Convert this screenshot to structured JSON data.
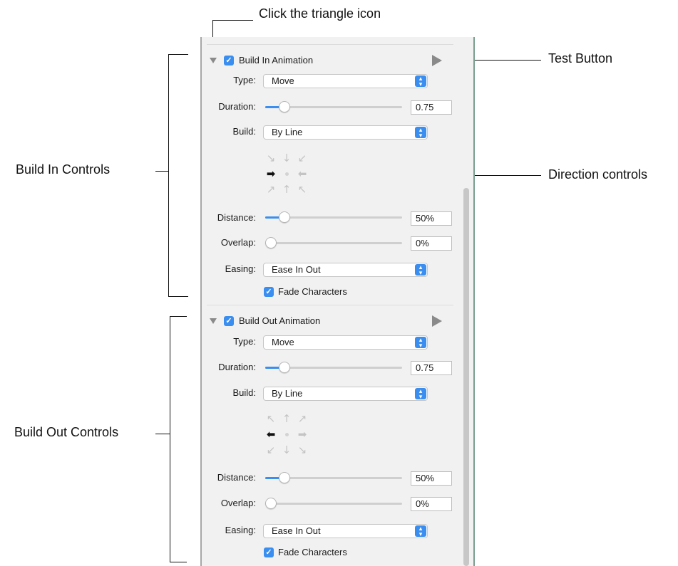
{
  "annotations": {
    "triangle_callout": "Click the triangle icon",
    "test_button_callout": "Test Button",
    "direction_callout": "Direction controls",
    "build_in_callout": "Build In Controls",
    "build_out_callout": "Build Out Controls"
  },
  "build_in": {
    "title": "Build In Animation",
    "enabled": true,
    "type_label": "Type:",
    "type_value": "Move",
    "duration_label": "Duration:",
    "duration_value": "0.75",
    "duration_level": 0.11,
    "build_label": "Build:",
    "build_value": "By Line",
    "direction": "right",
    "distance_label": "Distance:",
    "distance_value": "50%",
    "distance_level": 0.11,
    "overlap_label": "Overlap:",
    "overlap_value": "0%",
    "overlap_level": 0.0,
    "easing_label": "Easing:",
    "easing_value": "Ease In Out",
    "fade_label": "Fade Characters",
    "fade_checked": true
  },
  "build_out": {
    "title": "Build Out Animation",
    "enabled": true,
    "type_label": "Type:",
    "type_value": "Move",
    "duration_label": "Duration:",
    "duration_value": "0.75",
    "duration_level": 0.11,
    "build_label": "Build:",
    "build_value": "By Line",
    "direction": "left",
    "distance_label": "Distance:",
    "distance_value": "50%",
    "distance_level": 0.11,
    "overlap_label": "Overlap:",
    "overlap_value": "0%",
    "overlap_level": 0.0,
    "easing_label": "Easing:",
    "easing_value": "Ease In Out",
    "fade_label": "Fade Characters",
    "fade_checked": true
  },
  "icons": {
    "disclosure": "disclosure-triangle-icon",
    "play": "play-triangle-icon",
    "popup": "popup-chevron-icon",
    "check": "checkmark-icon"
  },
  "colors": {
    "accent": "#3a8ef0",
    "panel_bg": "#f1f1f1",
    "inactive_arrow": "#c4c4c4"
  }
}
